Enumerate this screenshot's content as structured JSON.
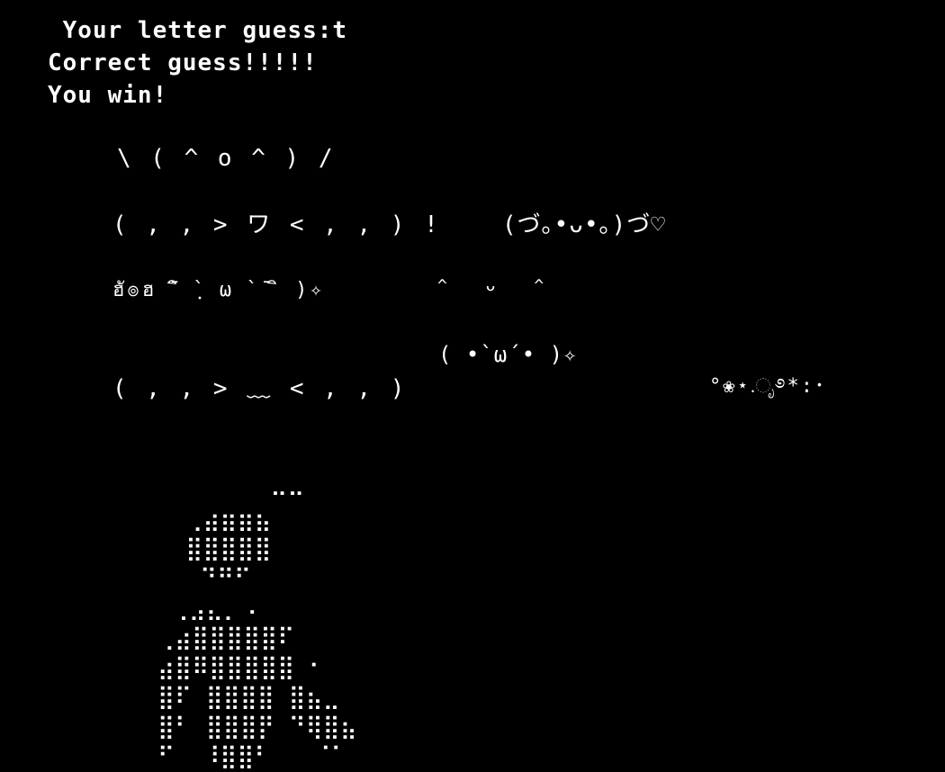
{
  "terminal": {
    "prompt_line": " Your letter guess:t",
    "result_line": "Correct guess!!!!!",
    "win_line": "You win!"
  },
  "emoticons": {
    "cheer": "\\ ( ^ o ^ ) /",
    "excited": "( , , > ワ < , , ) !",
    "hug": "(づ｡•ᴗ•｡)づ♡",
    "sparkle_blush": "ฮั๏ฮ ̄ ิ ̀ ฺ ω ̀ ̄ ิ )✧",
    "smile_top": "^ ᴗ ^",
    "sparkle": "( •`ω´• )✧",
    "flustered": "( , , > ﹏ < , , )",
    "flowers": "°❀⋆.ೃ࿔*:･"
  },
  "ascii_art": {
    "label": "braille-figure",
    "text": "        ⠤⠤\n  ⢀⣴⣶⣶⣦\n  ⣿⣿⣿⣿⣿\n   ⠙⠛⠋\n ⢀⣠⣄⡀⠠\n⢀⣴⣿⣿⣿⣿⣿⠏\n⣴⣿⠿⣿⣿⣿⣿⣿ ⠂\n⣿⠏ ⣿⣿⣿⣿ ⣿⣦⣀\n⣿⠃ ⣿⣿⣿⡟ ⠙⢿⣿⣦\n⠋  ⠸⣿⣿⠃   ⠈⠁"
  }
}
